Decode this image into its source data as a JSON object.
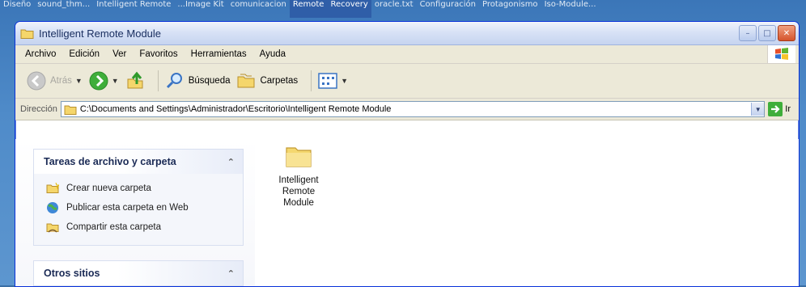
{
  "desktop": {
    "icons": [
      "Diseño",
      "sound_thm...",
      "Intelligent Remote",
      "...Image Kit",
      "comunicacion",
      "Remote",
      "Recovery",
      "oracle.txt",
      "Configuración",
      "Protagonismo",
      "Iso-Module..."
    ]
  },
  "window": {
    "title": "Intelligent Remote Module"
  },
  "menu": [
    "Archivo",
    "Edición",
    "Ver",
    "Favoritos",
    "Herramientas",
    "Ayuda"
  ],
  "toolbar": {
    "back_label": "Atrás",
    "search_label": "Búsqueda",
    "folders_label": "Carpetas"
  },
  "address": {
    "label": "Dirección",
    "path": "C:\\Documents and Settings\\Administrador\\Escritorio\\Intelligent Remote Module",
    "go_label": "Ir"
  },
  "taskpane": {
    "file_tasks_title": "Tareas de archivo y carpeta",
    "tasks": [
      {
        "label": "Crear nueva carpeta",
        "icon": "new-folder-icon"
      },
      {
        "label": "Publicar esta carpeta en Web",
        "icon": "globe-icon"
      },
      {
        "label": "Compartir esta carpeta",
        "icon": "share-folder-icon"
      }
    ],
    "other_sites_title": "Otros sitios"
  },
  "files": [
    {
      "name": "Intelligent Remote Module",
      "icon": "folder-icon"
    }
  ]
}
